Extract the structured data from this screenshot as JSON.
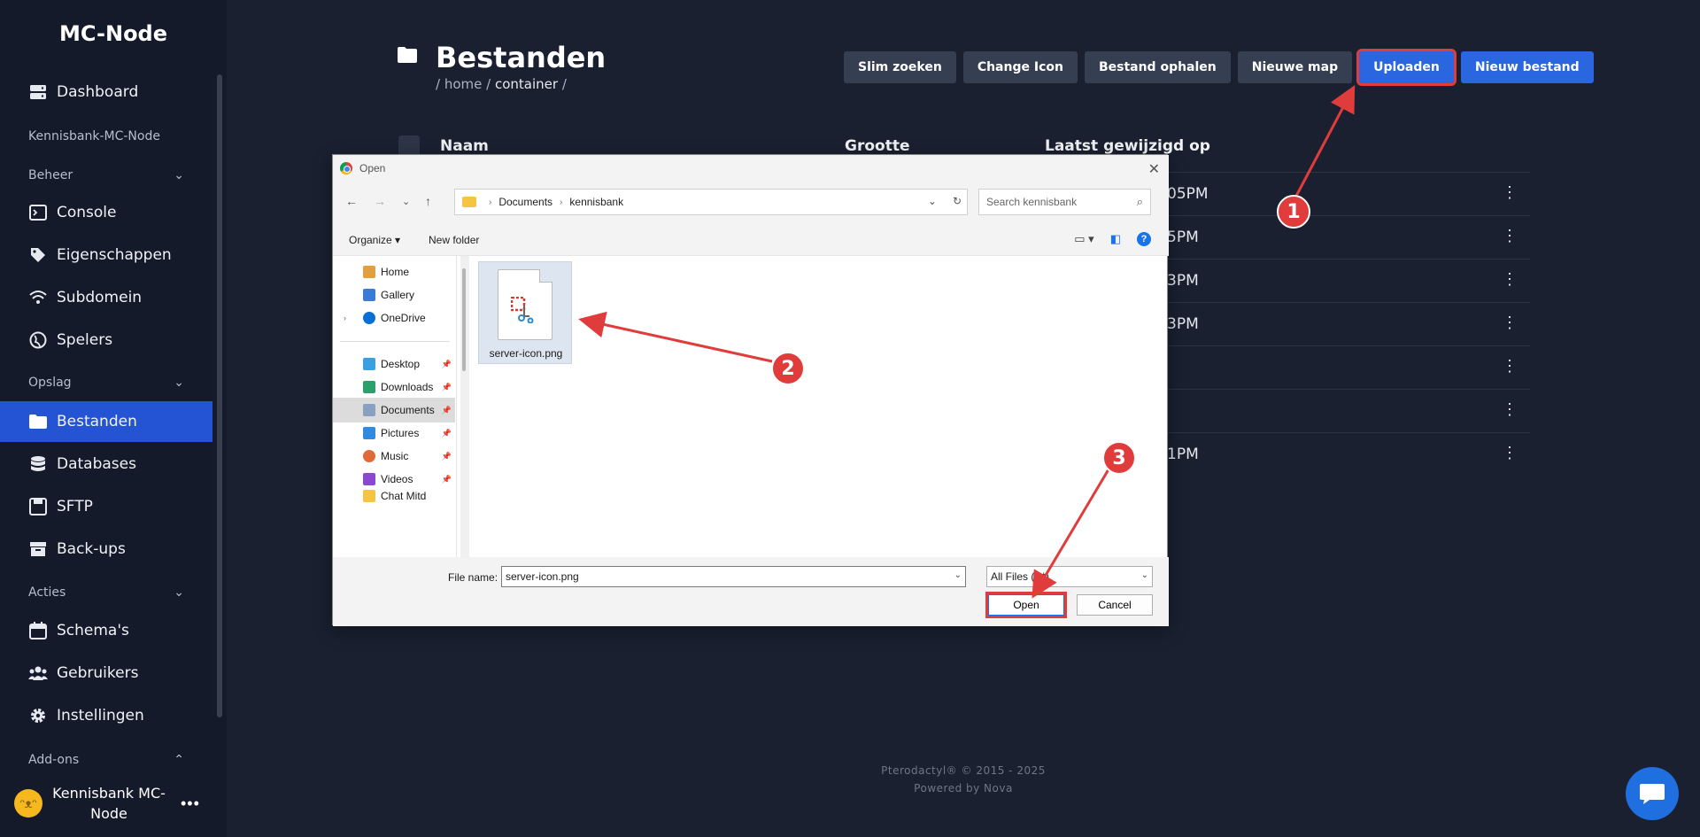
{
  "sidebar": {
    "brand": "MC-Node",
    "server_label": "Kennisbank-MC-Node",
    "sections": {
      "beheer": "Beheer",
      "opslag": "Opslag",
      "acties": "Acties",
      "addons": "Add-ons"
    },
    "items": {
      "dashboard": "Dashboard",
      "console": "Console",
      "eigenschappen": "Eigenschappen",
      "subdomein": "Subdomein",
      "spelers": "Spelers",
      "bestanden": "Bestanden",
      "databases": "Databases",
      "sftp": "SFTP",
      "backups": "Back-ups",
      "schemas": "Schema's",
      "gebruikers": "Gebruikers",
      "instellingen": "Instellingen"
    },
    "user": {
      "name_line1": "Kennisbank MC-",
      "name_line2": "Node",
      "more": "•••"
    }
  },
  "header": {
    "title": "Bestanden",
    "breadcrumb_prefix": "/ home /",
    "breadcrumb_current": "container",
    "breadcrumb_suffix": "/"
  },
  "toolbar": {
    "slim_zoeken": "Slim zoeken",
    "change_icon": "Change Icon",
    "bestand_ophalen": "Bestand ophalen",
    "nieuwe_map": "Nieuwe map",
    "uploaden": "Uploaden",
    "nieuw_bestand": "Nieuw bestand"
  },
  "table": {
    "col_name": "Naam",
    "col_size": "Grootte",
    "col_modified": "Laatst gewijzigd op",
    "row_times": [
      "05PM",
      "5PM",
      "3PM",
      "3PM",
      "",
      "",
      "1PM"
    ],
    "more": "⋮"
  },
  "footer": {
    "line1": "Pterodactyl® © 2015 - 2025",
    "line2": "Powered by Nova"
  },
  "dialog": {
    "title": "Open",
    "close": "✕",
    "path": [
      "Documents",
      "kennisbank"
    ],
    "search_placeholder": "Search kennisbank",
    "organize": "Organize ▾",
    "new_folder": "New folder",
    "nav": {
      "home": "Home",
      "gallery": "Gallery",
      "onedrive": "OneDrive",
      "desktop": "Desktop",
      "downloads": "Downloads",
      "documents": "Documents",
      "pictures": "Pictures",
      "music": "Music",
      "videos": "Videos",
      "partial": "Chat Mitd"
    },
    "file_name": "server-icon.png",
    "file_name_label": "File name:",
    "file_name_value": "server-icon.png",
    "filter": "All Files (*.*)",
    "open": "Open",
    "cancel": "Cancel"
  },
  "annotations": {
    "one": "1",
    "two": "2",
    "three": "3"
  },
  "colors": {
    "accent": "#2453d4",
    "annotation": "#e03c3c",
    "sidebar": "#141a2a",
    "background": "#1a2030"
  }
}
